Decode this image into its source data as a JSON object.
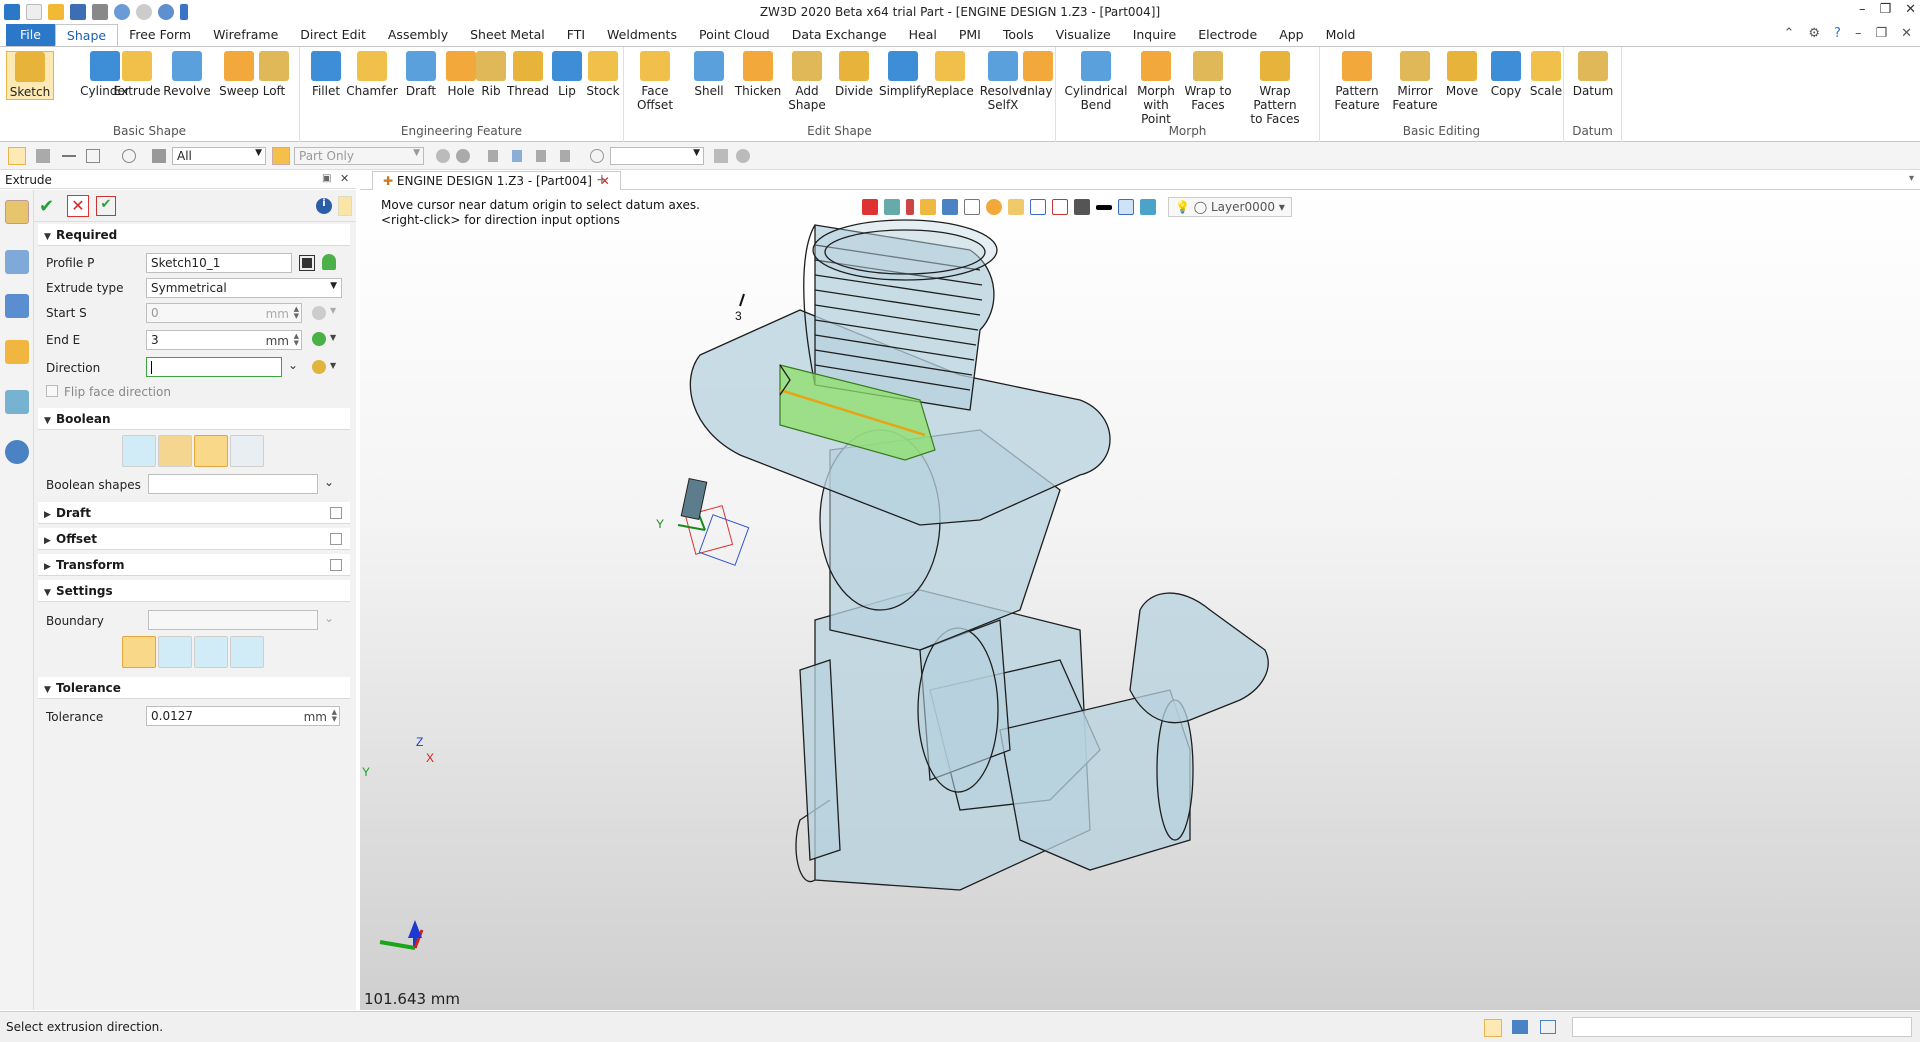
{
  "app": {
    "title": "ZW3D 2020 Beta x64 trial        Part - [ENGINE DESIGN 1.Z3 - [Part004]]"
  },
  "menu": {
    "tabs": [
      "File",
      "Shape",
      "Free Form",
      "Wireframe",
      "Direct Edit",
      "Assembly",
      "Sheet Metal",
      "FTI",
      "Weldments",
      "Point Cloud",
      "Data Exchange",
      "Heal",
      "PMI",
      "Tools",
      "Visualize",
      "Inquire",
      "Electrode",
      "App",
      "Mold"
    ],
    "active": "Shape"
  },
  "ribbon": {
    "groups": [
      {
        "name": "Basic Shape",
        "buttons": [
          "Sketch",
          "Cylinder",
          "Extrude",
          "Revolve",
          "Sweep",
          "Loft"
        ]
      },
      {
        "name": "Engineering Feature",
        "buttons": [
          "Fillet",
          "Chamfer",
          "Draft",
          "Hole",
          "Rib",
          "Thread",
          "Lip",
          "Stock"
        ]
      },
      {
        "name": "Edit Shape",
        "buttons": [
          "Face\nOffset",
          "Shell",
          "Thicken",
          "Add\nShape",
          "Divide",
          "Simplify",
          "Replace",
          "Resolve\nSelfX",
          "Inlay"
        ]
      },
      {
        "name": "Morph",
        "buttons": [
          "Cylindrical\nBend",
          "Morph with\nPoint",
          "Wrap to\nFaces",
          "Wrap Pattern\nto Faces"
        ]
      },
      {
        "name": "Basic Editing",
        "buttons": [
          "Pattern\nFeature",
          "Mirror\nFeature",
          "Move",
          "Copy",
          "Scale"
        ]
      },
      {
        "name": "Datum",
        "buttons": [
          "Datum"
        ]
      }
    ]
  },
  "toolbar2": {
    "filter": "All",
    "scope": "Part Only"
  },
  "panel": {
    "title": "Extrude",
    "required": {
      "header": "Required",
      "profile_label": "Profile P",
      "profile_value": "Sketch10_1",
      "extrude_type_label": "Extrude type",
      "extrude_type_value": "Symmetrical",
      "start_label": "Start S",
      "start_value": "0",
      "start_unit": "mm",
      "end_label": "End E",
      "end_value": "3",
      "end_unit": "mm",
      "direction_label": "Direction",
      "direction_value": "",
      "flip_label": "Flip face direction"
    },
    "boolean": {
      "header": "Boolean",
      "shapes_label": "Boolean shapes",
      "shapes_value": ""
    },
    "draft": {
      "header": "Draft"
    },
    "offset": {
      "header": "Offset"
    },
    "transform": {
      "header": "Transform"
    },
    "settings": {
      "header": "Settings",
      "boundary_label": "Boundary"
    },
    "tolerance": {
      "header": "Tolerance",
      "label": "Tolerance",
      "value": "0.0127",
      "unit": "mm"
    }
  },
  "document": {
    "tab": "ENGINE DESIGN 1.Z3 - [Part004]",
    "hint_line1": "Move cursor near datum origin to select datum axes.",
    "hint_line2": "<right-click> for direction input options",
    "layer": "Layer0000",
    "dimension": "101.643 mm",
    "triad_z": "Z",
    "triad_y": "Y",
    "triad_x": "X",
    "origin_y": "Y",
    "marker": "3"
  },
  "status": {
    "text": "Select extrusion direction."
  },
  "colors": {
    "accent": "#2b78c9",
    "part_fill": "#b9d4df",
    "highlight": "#8de06a",
    "edge": "#1b1b1b"
  }
}
